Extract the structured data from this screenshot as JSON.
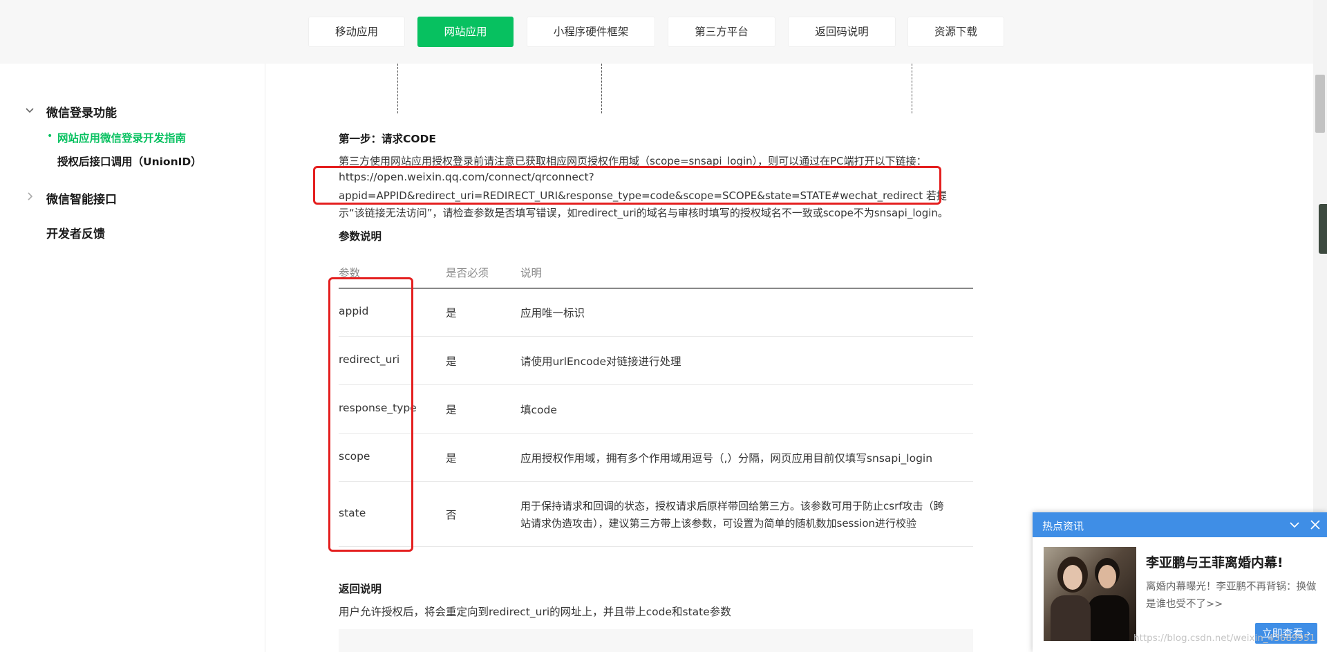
{
  "top_nav": {
    "tabs": [
      {
        "label": "移动应用"
      },
      {
        "label": "网站应用",
        "active": true
      },
      {
        "label": "小程序硬件框架"
      },
      {
        "label": "第三方平台"
      },
      {
        "label": "返回码说明"
      },
      {
        "label": "资源下载"
      }
    ]
  },
  "sidebar": {
    "section1": {
      "label": "微信登录功能",
      "expanded": true
    },
    "sub1": "网站应用微信登录开发指南",
    "sub1_bullet": "•",
    "sub2": "授权后接口调用（UnionID）",
    "section2": {
      "label": "微信智能接口",
      "expanded": false
    },
    "section3": "开发者反馈"
  },
  "main": {
    "step1_title": "第一步：请求CODE",
    "step1_intro": "第三方使用网站应用授权登录前请注意已获取相应网页授权作用域（scope=snsapi_login），则可以通过在PC端打开以下链接：",
    "url_line1": "https://open.weixin.qq.com/connect/qrconnect?",
    "url_line2": "appid=APPID&redirect_uri=REDIRECT_URI&response_type=code&scope=SCOPE&state=STATE#wechat_redirect 若提",
    "note_line": "示“该链接无法访问”，请检查参数是否填写错误，如redirect_uri的域名与审核时填写的授权域名不一致或scope不为snsapi_login。",
    "params_title": "参数说明",
    "table": {
      "headers": [
        "参数",
        "是否必须",
        "说明"
      ],
      "rows": [
        {
          "param": "appid",
          "required": "是",
          "desc": "应用唯一标识"
        },
        {
          "param": "redirect_uri",
          "required": "是",
          "desc": "请使用urlEncode对链接进行处理"
        },
        {
          "param": "response_type",
          "required": "是",
          "desc": "填code"
        },
        {
          "param": "scope",
          "required": "是",
          "desc": "应用授权作用域，拥有多个作用域用逗号（,）分隔，网页应用目前仅填写snsapi_login"
        },
        {
          "param": "state",
          "required": "否",
          "desc_line1": "用于保持请求和回调的状态，授权请求后原样带回给第三方。该参数可用于防止csrf攻击（跨",
          "desc_line2": "站请求伪造攻击），建议第三方带上该参数，可设置为简单的随机数加session进行校验"
        }
      ]
    },
    "return_title": "返回说明",
    "return_desc": "用户允许授权后，将会重定向到redirect_uri的网址上，并且带上code和state参数"
  },
  "popup": {
    "title": "热点资讯",
    "headline": "李亚鹏与王菲离婚内幕!",
    "desc": "离婚内幕曝光！李亚鹏不再背锅：换做是谁也受不了>>",
    "button": "立即查看 ›"
  },
  "watermark": "https://blog.csdn.net/weixin_43689951",
  "colors": {
    "accent": "#07c160",
    "highlight": "#e41f1f",
    "popup_blue": "#3f8ee6"
  }
}
